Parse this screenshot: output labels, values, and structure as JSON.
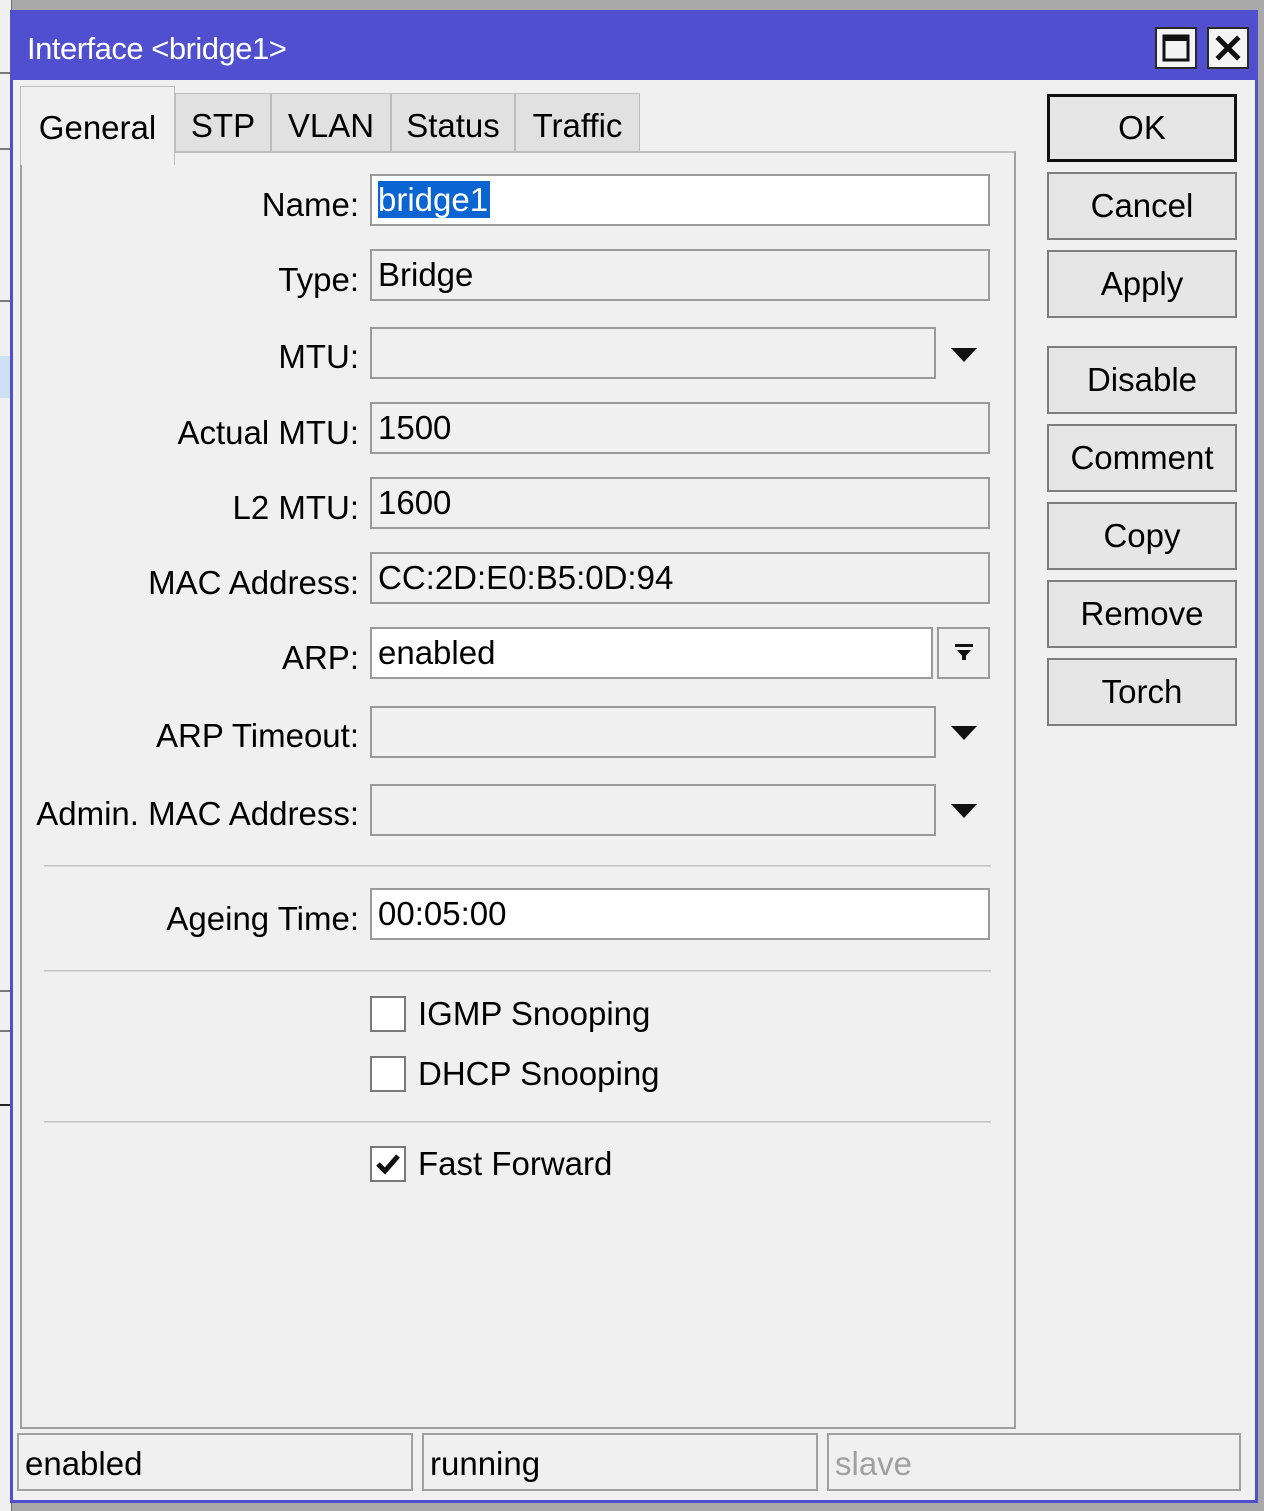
{
  "window": {
    "title": "Interface <bridge1>"
  },
  "tabs": [
    {
      "label": "General"
    },
    {
      "label": "STP"
    },
    {
      "label": "VLAN"
    },
    {
      "label": "Status"
    },
    {
      "label": "Traffic"
    }
  ],
  "fields": {
    "name": {
      "label": "Name:",
      "value": "bridge1"
    },
    "type": {
      "label": "Type:",
      "value": "Bridge"
    },
    "mtu": {
      "label": "MTU:",
      "value": ""
    },
    "actual_mtu": {
      "label": "Actual MTU:",
      "value": "1500"
    },
    "l2_mtu": {
      "label": "L2 MTU:",
      "value": "1600"
    },
    "mac_address": {
      "label": "MAC Address:",
      "value": "CC:2D:E0:B5:0D:94"
    },
    "arp": {
      "label": "ARP:",
      "value": "enabled"
    },
    "arp_timeout": {
      "label": "ARP Timeout:",
      "value": ""
    },
    "admin_mac": {
      "label": "Admin. MAC Address:",
      "value": ""
    },
    "ageing_time": {
      "label": "Ageing Time:",
      "value": "00:05:00"
    }
  },
  "checkboxes": {
    "igmp_snooping": {
      "label": "IGMP Snooping",
      "checked": false
    },
    "dhcp_snooping": {
      "label": "DHCP Snooping",
      "checked": false
    },
    "fast_forward": {
      "label": "Fast Forward",
      "checked": true
    }
  },
  "buttons": {
    "ok": "OK",
    "cancel": "Cancel",
    "apply": "Apply",
    "disable": "Disable",
    "comment": "Comment",
    "copy": "Copy",
    "remove": "Remove",
    "torch": "Torch"
  },
  "status_bar": {
    "state": "enabled",
    "running": "running",
    "slave": "slave"
  },
  "colors": {
    "titlebar": "#4f4fcf",
    "selection": "#0a64d2"
  }
}
